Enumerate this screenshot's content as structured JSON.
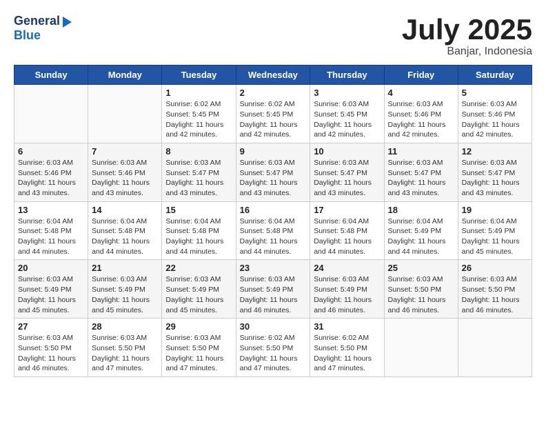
{
  "header": {
    "logo_general": "General",
    "logo_blue": "Blue",
    "month": "July 2025",
    "location": "Banjar, Indonesia"
  },
  "weekdays": [
    "Sunday",
    "Monday",
    "Tuesday",
    "Wednesday",
    "Thursday",
    "Friday",
    "Saturday"
  ],
  "weeks": [
    [
      {
        "day": "",
        "info": ""
      },
      {
        "day": "",
        "info": ""
      },
      {
        "day": "1",
        "info": "Sunrise: 6:02 AM\nSunset: 5:45 PM\nDaylight: 11 hours and 42 minutes."
      },
      {
        "day": "2",
        "info": "Sunrise: 6:02 AM\nSunset: 5:45 PM\nDaylight: 11 hours and 42 minutes."
      },
      {
        "day": "3",
        "info": "Sunrise: 6:03 AM\nSunset: 5:45 PM\nDaylight: 11 hours and 42 minutes."
      },
      {
        "day": "4",
        "info": "Sunrise: 6:03 AM\nSunset: 5:46 PM\nDaylight: 11 hours and 42 minutes."
      },
      {
        "day": "5",
        "info": "Sunrise: 6:03 AM\nSunset: 5:46 PM\nDaylight: 11 hours and 42 minutes."
      }
    ],
    [
      {
        "day": "6",
        "info": "Sunrise: 6:03 AM\nSunset: 5:46 PM\nDaylight: 11 hours and 43 minutes."
      },
      {
        "day": "7",
        "info": "Sunrise: 6:03 AM\nSunset: 5:46 PM\nDaylight: 11 hours and 43 minutes."
      },
      {
        "day": "8",
        "info": "Sunrise: 6:03 AM\nSunset: 5:47 PM\nDaylight: 11 hours and 43 minutes."
      },
      {
        "day": "9",
        "info": "Sunrise: 6:03 AM\nSunset: 5:47 PM\nDaylight: 11 hours and 43 minutes."
      },
      {
        "day": "10",
        "info": "Sunrise: 6:03 AM\nSunset: 5:47 PM\nDaylight: 11 hours and 43 minutes."
      },
      {
        "day": "11",
        "info": "Sunrise: 6:03 AM\nSunset: 5:47 PM\nDaylight: 11 hours and 43 minutes."
      },
      {
        "day": "12",
        "info": "Sunrise: 6:03 AM\nSunset: 5:47 PM\nDaylight: 11 hours and 43 minutes."
      }
    ],
    [
      {
        "day": "13",
        "info": "Sunrise: 6:04 AM\nSunset: 5:48 PM\nDaylight: 11 hours and 44 minutes."
      },
      {
        "day": "14",
        "info": "Sunrise: 6:04 AM\nSunset: 5:48 PM\nDaylight: 11 hours and 44 minutes."
      },
      {
        "day": "15",
        "info": "Sunrise: 6:04 AM\nSunset: 5:48 PM\nDaylight: 11 hours and 44 minutes."
      },
      {
        "day": "16",
        "info": "Sunrise: 6:04 AM\nSunset: 5:48 PM\nDaylight: 11 hours and 44 minutes."
      },
      {
        "day": "17",
        "info": "Sunrise: 6:04 AM\nSunset: 5:48 PM\nDaylight: 11 hours and 44 minutes."
      },
      {
        "day": "18",
        "info": "Sunrise: 6:04 AM\nSunset: 5:49 PM\nDaylight: 11 hours and 44 minutes."
      },
      {
        "day": "19",
        "info": "Sunrise: 6:04 AM\nSunset: 5:49 PM\nDaylight: 11 hours and 45 minutes."
      }
    ],
    [
      {
        "day": "20",
        "info": "Sunrise: 6:03 AM\nSunset: 5:49 PM\nDaylight: 11 hours and 45 minutes."
      },
      {
        "day": "21",
        "info": "Sunrise: 6:03 AM\nSunset: 5:49 PM\nDaylight: 11 hours and 45 minutes."
      },
      {
        "day": "22",
        "info": "Sunrise: 6:03 AM\nSunset: 5:49 PM\nDaylight: 11 hours and 45 minutes."
      },
      {
        "day": "23",
        "info": "Sunrise: 6:03 AM\nSunset: 5:49 PM\nDaylight: 11 hours and 46 minutes."
      },
      {
        "day": "24",
        "info": "Sunrise: 6:03 AM\nSunset: 5:49 PM\nDaylight: 11 hours and 46 minutes."
      },
      {
        "day": "25",
        "info": "Sunrise: 6:03 AM\nSunset: 5:50 PM\nDaylight: 11 hours and 46 minutes."
      },
      {
        "day": "26",
        "info": "Sunrise: 6:03 AM\nSunset: 5:50 PM\nDaylight: 11 hours and 46 minutes."
      }
    ],
    [
      {
        "day": "27",
        "info": "Sunrise: 6:03 AM\nSunset: 5:50 PM\nDaylight: 11 hours and 46 minutes."
      },
      {
        "day": "28",
        "info": "Sunrise: 6:03 AM\nSunset: 5:50 PM\nDaylight: 11 hours and 47 minutes."
      },
      {
        "day": "29",
        "info": "Sunrise: 6:03 AM\nSunset: 5:50 PM\nDaylight: 11 hours and 47 minutes."
      },
      {
        "day": "30",
        "info": "Sunrise: 6:02 AM\nSunset: 5:50 PM\nDaylight: 11 hours and 47 minutes."
      },
      {
        "day": "31",
        "info": "Sunrise: 6:02 AM\nSunset: 5:50 PM\nDaylight: 11 hours and 47 minutes."
      },
      {
        "day": "",
        "info": ""
      },
      {
        "day": "",
        "info": ""
      }
    ]
  ]
}
